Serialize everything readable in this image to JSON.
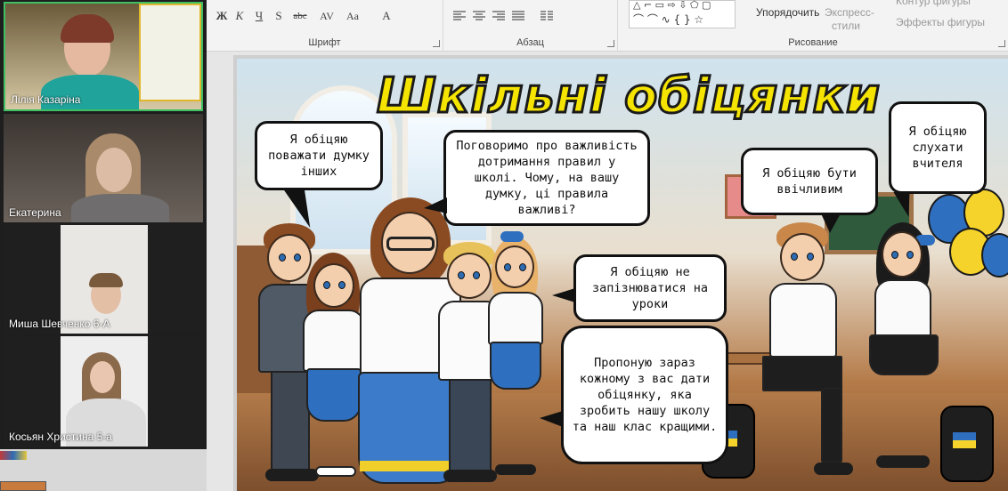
{
  "ribbon": {
    "font": {
      "group_label": "Шрифт",
      "bold": "Ж",
      "italic": "К",
      "underline": "Ч",
      "shadow": "S",
      "strike": "abc",
      "spacing": "AV",
      "case": "Aa",
      "clear": "A"
    },
    "paragraph": {
      "group_label": "Абзац"
    },
    "drawing": {
      "group_label": "Рисование",
      "arrange": "Упорядочить",
      "quick_styles": "Экспресс-",
      "quick_styles_2": "стили",
      "shape_outline": "Контур фигуры",
      "shape_effects": "Эффекты фигуры",
      "shapes_row1": "△ ⌐ ▭ ⇨ ⇩ ⬠ ▢",
      "shapes_row2": "⌒ ⌒ ∿ { } ☆"
    }
  },
  "participants": [
    {
      "name": "Лілія Казаріна",
      "active": true
    },
    {
      "name": "Екатерина",
      "active": false
    },
    {
      "name": "Миша Шевченко 6-А",
      "active": false
    },
    {
      "name": "Косьян Христина 5-а",
      "active": false
    }
  ],
  "slide": {
    "title": "Шкільні обіцянки",
    "bubbles": {
      "respect": "Я обіцяю поважати думку інших",
      "teacher": "Поговоримо про важливість дотримання правил у школі. Чому, на вашу думку, ці правила важливі?",
      "polite": "Я обіцяю бути ввічливим",
      "listen": "Я обіцяю слухати вчителя",
      "late": "Я обіцяю не запізнюватися на уроки",
      "offer": "Пропоную зараз кожному з вас дати обіцянку, яка зробить нашу школу та наш клас кращими."
    }
  },
  "colors": {
    "title_fill": "#f5e300",
    "active_border": "#3fbf62",
    "blue": "#2f6fc0",
    "yellow": "#f6d32a"
  }
}
